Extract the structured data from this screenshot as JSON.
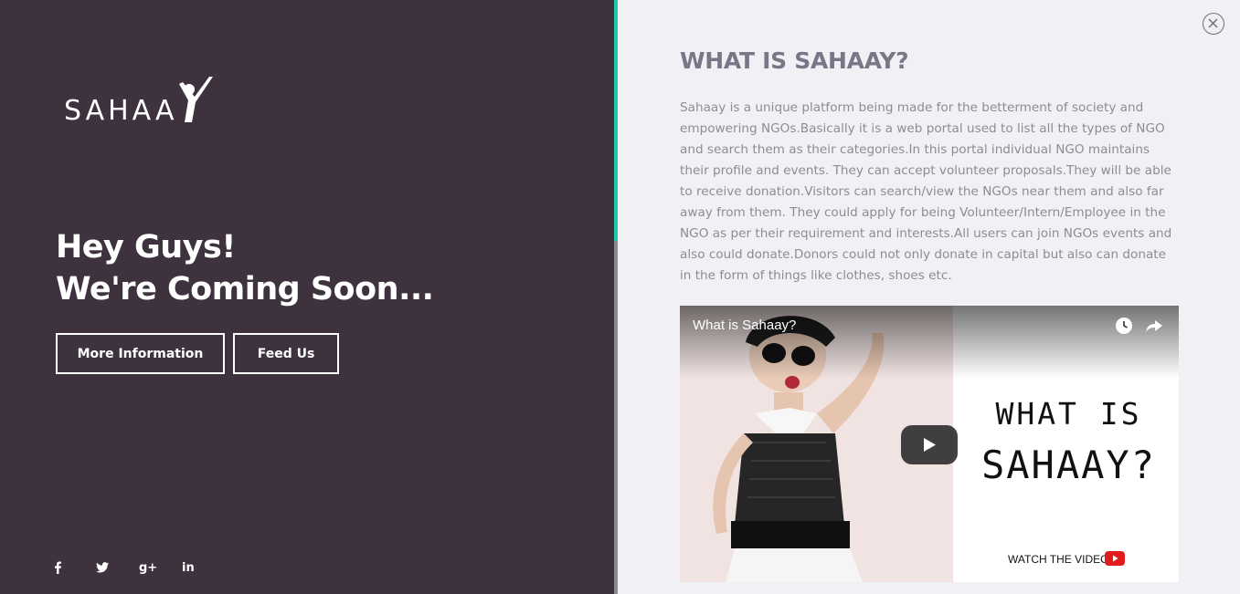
{
  "brand": {
    "logo_text": "SAHAA"
  },
  "hero": {
    "line1": "Hey Guys!",
    "line2": "We're Coming Soon...",
    "more_button": "More Information",
    "feed_button": "Feed Us"
  },
  "socials": [
    {
      "icon": "facebook-icon",
      "glyph": "f"
    },
    {
      "icon": "twitter-icon",
      "glyph": "t"
    },
    {
      "icon": "google-plus-icon",
      "glyph": "g+"
    },
    {
      "icon": "linkedin-icon",
      "glyph": "in"
    }
  ],
  "about": {
    "title": "WHAT IS SAHAAY?",
    "body": "Sahaay is a unique platform being made for the betterment of society and empowering NGOs.Basically it is a web portal used to list all the types of NGO and search them as their categories.In this portal individual NGO maintains their profile and events. They can accept volunteer proposals.They will be able to receive donation.Visitors can search/view the NGOs near them and also far away from them. They could apply for being Volunteer/Intern/Employee in the NGO as per their requirement and interests.All users can join NGOs events and also could donate.Donors could not only donate in capital but also can donate in the form of things like clothes, shoes etc."
  },
  "video": {
    "title": "What is Sahaay?",
    "thumb_line1": "WHAT IS",
    "thumb_line2": "SAHAAY?",
    "watch_label": "WATCH THE VIDEO"
  },
  "colors": {
    "left_bg": "#3f323f",
    "right_bg": "#f1f1f5",
    "accent": "#1fc8a8",
    "title": "#777787",
    "body_text": "#8c8c94"
  }
}
